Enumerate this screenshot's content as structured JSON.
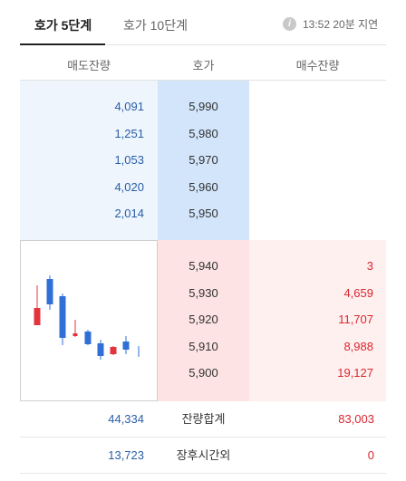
{
  "tabs": [
    {
      "label": "호가 5단계"
    },
    {
      "label": "호가 10단계"
    }
  ],
  "status": {
    "time": "13:52 20분 지연"
  },
  "columns": {
    "ask_volume": "매도잔량",
    "price": "호가",
    "bid_volume": "매수잔량"
  },
  "asks": [
    {
      "volume": "4,091",
      "price": "5,990"
    },
    {
      "volume": "1,251",
      "price": "5,980"
    },
    {
      "volume": "1,053",
      "price": "5,970"
    },
    {
      "volume": "4,020",
      "price": "5,960"
    },
    {
      "volume": "2,014",
      "price": "5,950"
    }
  ],
  "bids": [
    {
      "price": "5,940",
      "volume": "3"
    },
    {
      "price": "5,930",
      "volume": "4,659"
    },
    {
      "price": "5,920",
      "volume": "11,707"
    },
    {
      "price": "5,910",
      "volume": "8,988"
    },
    {
      "price": "5,900",
      "volume": "19,127"
    }
  ],
  "summary": {
    "total": {
      "ask": "44,334",
      "label": "잔량합계",
      "bid": "83,003"
    },
    "after_hours": {
      "ask": "13,723",
      "label": "장후시간외",
      "bid": "0"
    }
  },
  "colors": {
    "up": "#e0353d",
    "down": "#2f6fd6"
  },
  "mini_chart": {
    "type": "candlestick",
    "candles": [
      {
        "dir": "up"
      },
      {
        "dir": "down"
      },
      {
        "dir": "down"
      },
      {
        "dir": "up"
      },
      {
        "dir": "down"
      },
      {
        "dir": "down"
      },
      {
        "dir": "up"
      },
      {
        "dir": "down"
      },
      {
        "dir": "down"
      }
    ]
  }
}
